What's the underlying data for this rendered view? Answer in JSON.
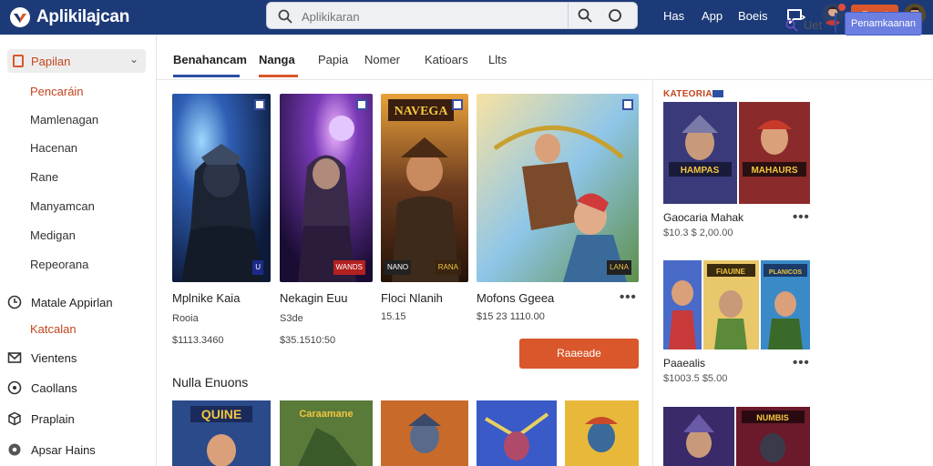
{
  "app": {
    "brand": "Aplikilajcan",
    "search_placeholder": "Aplikikaran",
    "nav_links": [
      "Has",
      "App",
      "Boeis"
    ],
    "top_cta": "Raad"
  },
  "sidebar": {
    "head": "Papilan",
    "items": [
      "Pencaráin",
      "Mamlenagan",
      "Hacenan",
      "Rane",
      "Manyamcan",
      "Medigan",
      "Repeorana"
    ],
    "active_index": 0,
    "sections": [
      {
        "label": "Matale Appirlan",
        "icon": "clock-icon"
      },
      {
        "label": "Katcalan",
        "icon": ""
      },
      {
        "label": "Vientens",
        "icon": "mail-icon"
      },
      {
        "label": "Caollans",
        "icon": "info-icon"
      },
      {
        "label": "Praplain",
        "icon": "cube-icon"
      },
      {
        "label": "Apsar Hains",
        "icon": "gear-icon"
      }
    ]
  },
  "tabs": {
    "items": [
      "Benahancam",
      "Nanga",
      "Papia",
      "Nomer",
      "Katioars",
      "Llts"
    ],
    "filter_label": "Uet",
    "primary_button": "Penamkaanan"
  },
  "main": {
    "cards": [
      {
        "title": "Mplnike Kaia",
        "price": "Rooia",
        "meta": "$1113.3460"
      },
      {
        "title": "Nekagin Euu",
        "price": "S3de",
        "meta": "$35.1510:50"
      },
      {
        "title": "Floci Nlanih",
        "price": "",
        "meta": "15.15"
      },
      {
        "title": "Mofons Ggeea",
        "price": "",
        "meta": "$15 23 1110.00"
      }
    ],
    "card_tags": [
      "U",
      "WANDS",
      "NANO",
      "RANA",
      "LANA"
    ],
    "card_banner_text": "NAVEGA",
    "cta_button": "Raaeade",
    "section_title": "Nulla Enuons",
    "thumb_titles": [
      "QUINE",
      "Caraamane"
    ]
  },
  "right": {
    "heading": "KATEORIA",
    "items": [
      {
        "title": "Gaocaria Mahak",
        "meta": "$10.3 $ 2,00.00"
      },
      {
        "title": "Paaealis",
        "meta": "$1003.5 $5.00"
      }
    ],
    "tile_text": [
      "HAMPAS",
      "MAHAURS",
      "FIAUINE",
      "PLANICOS",
      "NUMBIS"
    ]
  }
}
